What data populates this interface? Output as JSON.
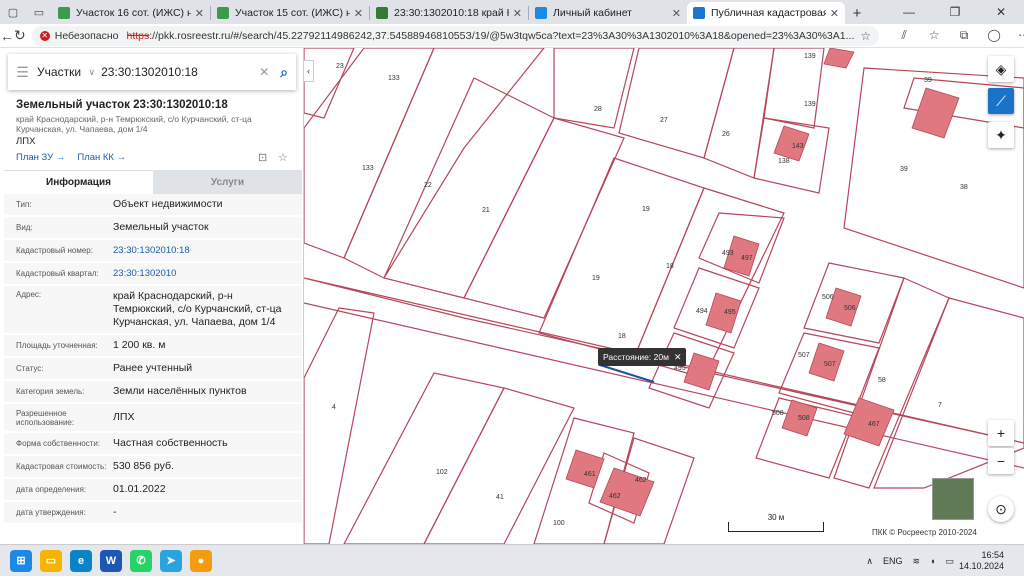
{
  "browser": {
    "tabs": [
      {
        "label": "Участок 16 сот. (ИЖС) на продаж",
        "fav_color": "#3a9c4a"
      },
      {
        "label": "Участок 15 сот. (ИЖС) на продаж",
        "fav_color": "#3a9c4a"
      },
      {
        "label": "23:30:1302010:18 край Краснодарс",
        "fav_color": "#2e7d32"
      },
      {
        "label": "Личный кабинет",
        "fav_color": "#1e88e5"
      },
      {
        "label": "Публичная кадастровая карта",
        "fav_color": "#1976d2"
      }
    ],
    "new_tab": "+",
    "insecure_label": "Небезопасно",
    "url_scheme": "https",
    "url_rest": "://pkk.rosreestr.ru/#/search/45.22792114986242,37.5458894681055З/19/@5w3tqw5ca?text=23%3A30%3A1302010%3A18&opened=23%3A30%3A1...",
    "window_controls": [
      "—",
      "❐",
      "✕"
    ]
  },
  "search": {
    "category": "Участки",
    "query": "23:30:1302010:18"
  },
  "object": {
    "title": "Земельный участок 23:30:1302010:18",
    "address_short": "край Краснодарский, р-н Темрюкский, с/о Курчанский, ст-ца Курчанская, ул. Чапаева, дом 1/4",
    "type": "ЛПХ",
    "plan_zu": "План ЗУ →",
    "plan_kk": "План КК →"
  },
  "tabs": {
    "info": "Информация",
    "services": "Услуги"
  },
  "attributes": [
    {
      "key": "Тип:",
      "value": "Объект недвижимости",
      "link": false
    },
    {
      "key": "Вид:",
      "value": "Земельный участок",
      "link": false
    },
    {
      "key": "Кадастровый номер:",
      "value": "23:30:1302010:18",
      "link": true
    },
    {
      "key": "Кадастровый квартал:",
      "value": "23:30:1302010",
      "link": true
    },
    {
      "key": "Адрес:",
      "value": "край Краснодарский, р-н Темрюкский, с/о Курчанский, ст-ца Курчанская, ул. Чапаева, дом 1/4",
      "link": false
    },
    {
      "key": "Площадь уточненная:",
      "value": "1 200 кв. м",
      "link": false
    },
    {
      "key": "Статус:",
      "value": "Ранее учтенный",
      "link": false
    },
    {
      "key": "Категория земель:",
      "value": "Земли населённых пунктов",
      "link": false
    },
    {
      "key": "Разрешенное использование:",
      "value": "ЛПХ",
      "link": false
    },
    {
      "key": "Форма собственности:",
      "value": "Частная собственность",
      "link": false
    },
    {
      "key": "Кадастровая стоимость:",
      "value": "530 856 руб.",
      "link": false
    },
    {
      "key": "дата определения:",
      "value": "01.01.2022",
      "link": false
    },
    {
      "key": "дата утверждения:",
      "value": "-",
      "link": false
    }
  ],
  "map": {
    "parcel_labels": [
      "23",
      "133",
      "28",
      "27",
      "26",
      "139",
      "139",
      "138",
      "143",
      "39",
      "38",
      "39",
      "133",
      "22",
      "21",
      "19",
      "19",
      "18",
      "493",
      "497",
      "494",
      "495",
      "18",
      "495",
      "506",
      "506",
      "507",
      "507",
      "508",
      "508",
      "58",
      "7",
      "4",
      "102",
      "41",
      "100",
      "461",
      "462",
      "462",
      "467"
    ],
    "distance_label": "Расстояние: 20м",
    "scale_label": "30 м",
    "copyright": "ПКК © Росреестр 2010-2024",
    "line_color": "#b5475a",
    "building_color": "#e0787f"
  },
  "taskbar": {
    "lang": "ENG",
    "time": "16:54",
    "date": "14.10.2024"
  }
}
